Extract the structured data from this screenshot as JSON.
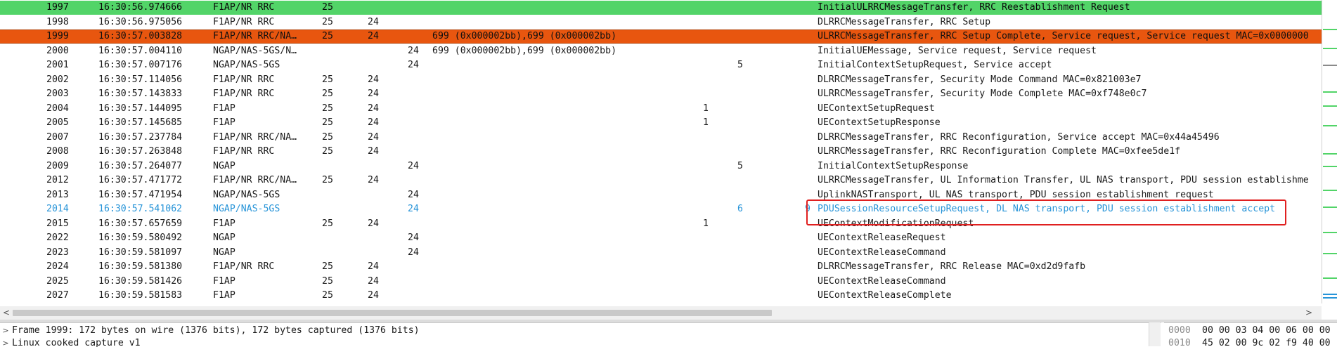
{
  "packets": [
    {
      "no": "1997",
      "time": "16:30:56.974666",
      "proto": "F1AP/NR RRC",
      "a": "25",
      "b": "",
      "c": "",
      "ids": "",
      "d": "",
      "e": "",
      "pre": "",
      "info": "InitialULRRCMessageTransfer, RRC Reestablishment Request",
      "style": "green"
    },
    {
      "no": "1998",
      "time": "16:30:56.975056",
      "proto": "F1AP/NR RRC",
      "a": "25",
      "b": "24",
      "c": "",
      "ids": "",
      "d": "",
      "e": "",
      "pre": "",
      "info": "DLRRCMessageTransfer, RRC Setup",
      "style": ""
    },
    {
      "no": "1999",
      "time": "16:30:57.003828",
      "proto": "F1AP/NR RRC/NA…",
      "a": "25",
      "b": "24",
      "c": "",
      "ids": "699 (0x000002bb),699 (0x000002bb)",
      "d": "",
      "e": "",
      "pre": "",
      "info": "ULRRCMessageTransfer, RRC Setup Complete, Service request, Service request MAC=0x0000000",
      "style": "selected"
    },
    {
      "no": "2000",
      "time": "16:30:57.004110",
      "proto": "NGAP/NAS-5GS/N…",
      "a": "",
      "b": "",
      "c": "24",
      "ids": "699 (0x000002bb),699 (0x000002bb)",
      "d": "",
      "e": "",
      "pre": "",
      "info": "InitialUEMessage, Service request, Service request",
      "style": ""
    },
    {
      "no": "2001",
      "time": "16:30:57.007176",
      "proto": "NGAP/NAS-5GS",
      "a": "",
      "b": "",
      "c": "24",
      "ids": "",
      "d": "",
      "e": "5",
      "pre": "",
      "info": "InitialContextSetupRequest, Service accept",
      "style": ""
    },
    {
      "no": "2002",
      "time": "16:30:57.114056",
      "proto": "F1AP/NR RRC",
      "a": "25",
      "b": "24",
      "c": "",
      "ids": "",
      "d": "",
      "e": "",
      "pre": "",
      "info": "DLRRCMessageTransfer, Security Mode Command MAC=0x821003e7",
      "style": ""
    },
    {
      "no": "2003",
      "time": "16:30:57.143833",
      "proto": "F1AP/NR RRC",
      "a": "25",
      "b": "24",
      "c": "",
      "ids": "",
      "d": "",
      "e": "",
      "pre": "",
      "info": "ULRRCMessageTransfer, Security Mode Complete MAC=0xf748e0c7",
      "style": ""
    },
    {
      "no": "2004",
      "time": "16:30:57.144095",
      "proto": "F1AP",
      "a": "25",
      "b": "24",
      "c": "",
      "ids": "",
      "d": "1",
      "e": "",
      "pre": "",
      "info": "UEContextSetupRequest",
      "style": ""
    },
    {
      "no": "2005",
      "time": "16:30:57.145685",
      "proto": "F1AP",
      "a": "25",
      "b": "24",
      "c": "",
      "ids": "",
      "d": "1",
      "e": "",
      "pre": "",
      "info": "UEContextSetupResponse",
      "style": ""
    },
    {
      "no": "2007",
      "time": "16:30:57.237784",
      "proto": "F1AP/NR RRC/NA…",
      "a": "25",
      "b": "24",
      "c": "",
      "ids": "",
      "d": "",
      "e": "",
      "pre": "",
      "info": "DLRRCMessageTransfer, RRC Reconfiguration, Service accept MAC=0x44a45496",
      "style": ""
    },
    {
      "no": "2008",
      "time": "16:30:57.263848",
      "proto": "F1AP/NR RRC",
      "a": "25",
      "b": "24",
      "c": "",
      "ids": "",
      "d": "",
      "e": "",
      "pre": "",
      "info": "ULRRCMessageTransfer, RRC Reconfiguration Complete MAC=0xfee5de1f",
      "style": ""
    },
    {
      "no": "2009",
      "time": "16:30:57.264077",
      "proto": "NGAP",
      "a": "",
      "b": "",
      "c": "24",
      "ids": "",
      "d": "",
      "e": "5",
      "pre": "",
      "info": "InitialContextSetupResponse",
      "style": ""
    },
    {
      "no": "2012",
      "time": "16:30:57.471772",
      "proto": "F1AP/NR RRC/NA…",
      "a": "25",
      "b": "24",
      "c": "",
      "ids": "",
      "d": "",
      "e": "",
      "pre": "",
      "info": "ULRRCMessageTransfer, UL Information Transfer, UL NAS transport, PDU session establishme",
      "style": ""
    },
    {
      "no": "2013",
      "time": "16:30:57.471954",
      "proto": "NGAP/NAS-5GS",
      "a": "",
      "b": "",
      "c": "24",
      "ids": "",
      "d": "",
      "e": "",
      "pre": "",
      "info": "UplinkNASTransport, UL NAS transport, PDU session establishment request",
      "style": ""
    },
    {
      "no": "2014",
      "time": "16:30:57.541062",
      "proto": "NGAP/NAS-5GS",
      "a": "",
      "b": "",
      "c": "24",
      "ids": "",
      "d": "",
      "e": "6",
      "pre": "9",
      "info": "PDUSessionResourceSetupRequest, DL NAS transport, PDU session establishment accept",
      "style": "blue"
    },
    {
      "no": "2015",
      "time": "16:30:57.657659",
      "proto": "F1AP",
      "a": "25",
      "b": "24",
      "c": "",
      "ids": "",
      "d": "1",
      "e": "",
      "pre": "",
      "info": "UEContextModificationRequest",
      "style": ""
    },
    {
      "no": "2022",
      "time": "16:30:59.580492",
      "proto": "NGAP",
      "a": "",
      "b": "",
      "c": "24",
      "ids": "",
      "d": "",
      "e": "",
      "pre": "",
      "info": "UEContextReleaseRequest",
      "style": ""
    },
    {
      "no": "2023",
      "time": "16:30:59.581097",
      "proto": "NGAP",
      "a": "",
      "b": "",
      "c": "24",
      "ids": "",
      "d": "",
      "e": "",
      "pre": "",
      "info": "UEContextReleaseCommand",
      "style": ""
    },
    {
      "no": "2024",
      "time": "16:30:59.581380",
      "proto": "F1AP/NR RRC",
      "a": "25",
      "b": "24",
      "c": "",
      "ids": "",
      "d": "",
      "e": "",
      "pre": "",
      "info": "DLRRCMessageTransfer, RRC Release MAC=0xd2d9fafb",
      "style": ""
    },
    {
      "no": "2025",
      "time": "16:30:59.581426",
      "proto": "F1AP",
      "a": "25",
      "b": "24",
      "c": "",
      "ids": "",
      "d": "",
      "e": "",
      "pre": "",
      "info": "UEContextReleaseCommand",
      "style": ""
    },
    {
      "no": "2027",
      "time": "16:30:59.581583",
      "proto": "F1AP",
      "a": "25",
      "b": "24",
      "c": "",
      "ids": "",
      "d": "",
      "e": "",
      "pre": "",
      "info": "UEContextReleaseComplete",
      "style": ""
    }
  ],
  "details": [
    {
      "expander": ">",
      "text": "Frame 1999: 172 bytes on wire (1376 bits), 172 bytes captured (1376 bits)"
    },
    {
      "expander": ">",
      "text": "Linux cooked capture v1"
    }
  ],
  "bytes": [
    {
      "offset": "0000",
      "hex": "00 00 03 04 00 06 00 00"
    },
    {
      "offset": "0010",
      "hex": "45 02 00 9c 02 f9 40 00"
    }
  ],
  "scroll": {
    "left_arrow": "<",
    "right_arrow": ">"
  },
  "colors": {
    "green_row": "#52d468",
    "selected_row": "#e8560f",
    "linked_row_text": "#2794d8",
    "highlight_box": "#e02020"
  }
}
